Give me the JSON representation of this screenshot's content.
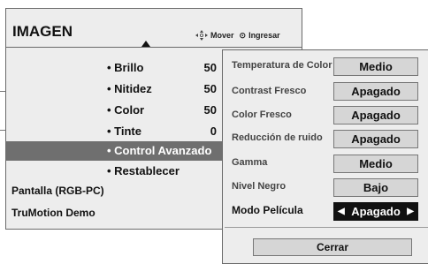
{
  "header": {
    "title": "IMAGEN",
    "move_label": "Mover",
    "enter_label": "Ingresar",
    "move_icon": "dpad-icon",
    "enter_icon": "ok-button-icon"
  },
  "menu": {
    "items": [
      {
        "label": "• Brillo",
        "value": "50"
      },
      {
        "label": "• Nitidez",
        "value": "50"
      },
      {
        "label": "• Color",
        "value": "50"
      },
      {
        "label": "• Tinte",
        "value": "0"
      },
      {
        "label": "• Control Avanzado",
        "value": ""
      },
      {
        "label": "• Restablecer",
        "value": ""
      }
    ],
    "extra_items": [
      "Pantalla (RGB-PC)",
      "TruMotion Demo"
    ]
  },
  "submenu": {
    "rows": [
      {
        "label": "Temperatura de Color",
        "value": "Medio"
      },
      {
        "label": "Contrast Fresco",
        "value": "Apagado"
      },
      {
        "label": "Color Fresco",
        "value": "Apagado"
      },
      {
        "label": "Reducción de ruido",
        "value": "Apagado"
      },
      {
        "label": "Gamma",
        "value": "Medio"
      },
      {
        "label": "Nivel Negro",
        "value": "Bajo"
      },
      {
        "label": "Modo Película",
        "value": "Apagado"
      }
    ],
    "close_label": "Cerrar"
  },
  "colors": {
    "panel_bg": "#ededed",
    "highlight": "#6f6f6f",
    "selected_value_bg": "#111111"
  }
}
